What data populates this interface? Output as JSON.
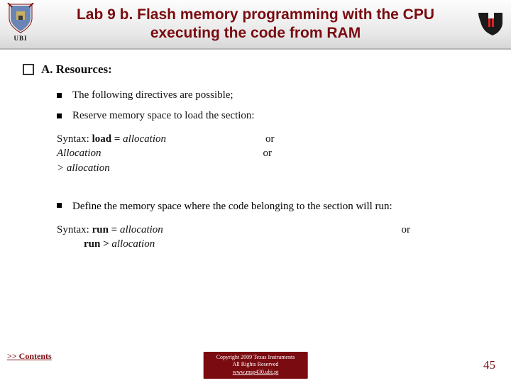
{
  "header": {
    "ubi_label": "UBI",
    "title": "Lab 9 b. Flash memory programming with the CPU executing the code from RAM"
  },
  "content": {
    "heading": "A. Resources:",
    "bullet1": "The following directives are possible;",
    "bullet2": "Reserve memory space to load the section:",
    "syntax1": {
      "prefix": "Syntax: ",
      "kw": "load = ",
      "var1": "allocation",
      "or1": "or",
      "line2_var": "Allocation",
      "or2": "or",
      "line3": "> allocation"
    },
    "bullet3": "Define the memory space where the code belonging to the section will run:",
    "syntax2": {
      "prefix": "Syntax: ",
      "kw": "run = ",
      "var1": "allocation",
      "or": "or",
      "line2_indent_kw": "run > ",
      "line2_var": "allocation"
    }
  },
  "nav": {
    "contents_label": ">> Contents"
  },
  "footer": {
    "copyright_line1": "Copyright  2009 Texas Instruments",
    "copyright_line2": "All Rights Reserved",
    "url": "www.msp430.ubi.pt",
    "page_number": "45"
  }
}
